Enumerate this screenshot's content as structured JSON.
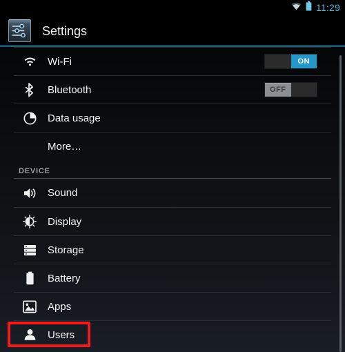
{
  "status_bar": {
    "wifi_icon": "wifi-icon",
    "battery_icon": "battery-icon",
    "clock": "11:29",
    "accent_color": "#5fb9d8"
  },
  "action_bar": {
    "app_icon": "settings-sliders-icon",
    "title": "Settings",
    "accent_color": "#1d5b77"
  },
  "list": {
    "rows": [
      {
        "id": "wifi",
        "label": "Wi-Fi",
        "icon": "wifi-icon",
        "toggle": {
          "state": "on",
          "label": "ON",
          "color": "#2497c8"
        }
      },
      {
        "id": "bluetooth",
        "label": "Bluetooth",
        "icon": "bluetooth-icon",
        "toggle": {
          "state": "off",
          "label": "OFF",
          "color": "#8b8f93"
        }
      },
      {
        "id": "data-usage",
        "label": "Data usage",
        "icon": "pie-chart-icon",
        "toggle": null
      },
      {
        "id": "more",
        "label": "More…",
        "icon": null,
        "toggle": null
      }
    ],
    "section": {
      "label": "DEVICE",
      "rows": [
        {
          "id": "sound",
          "label": "Sound",
          "icon": "speaker-icon"
        },
        {
          "id": "display",
          "label": "Display",
          "icon": "brightness-icon"
        },
        {
          "id": "storage",
          "label": "Storage",
          "icon": "storage-bars-icon"
        },
        {
          "id": "battery",
          "label": "Battery",
          "icon": "battery-icon"
        },
        {
          "id": "apps",
          "label": "Apps",
          "icon": "apps-image-icon"
        },
        {
          "id": "users",
          "label": "Users",
          "icon": "person-icon"
        }
      ]
    },
    "scrollbar": "vertical-scrollbar"
  },
  "annotation": {
    "highlight_target": "Users",
    "highlight_color": "#ee1c1c"
  }
}
